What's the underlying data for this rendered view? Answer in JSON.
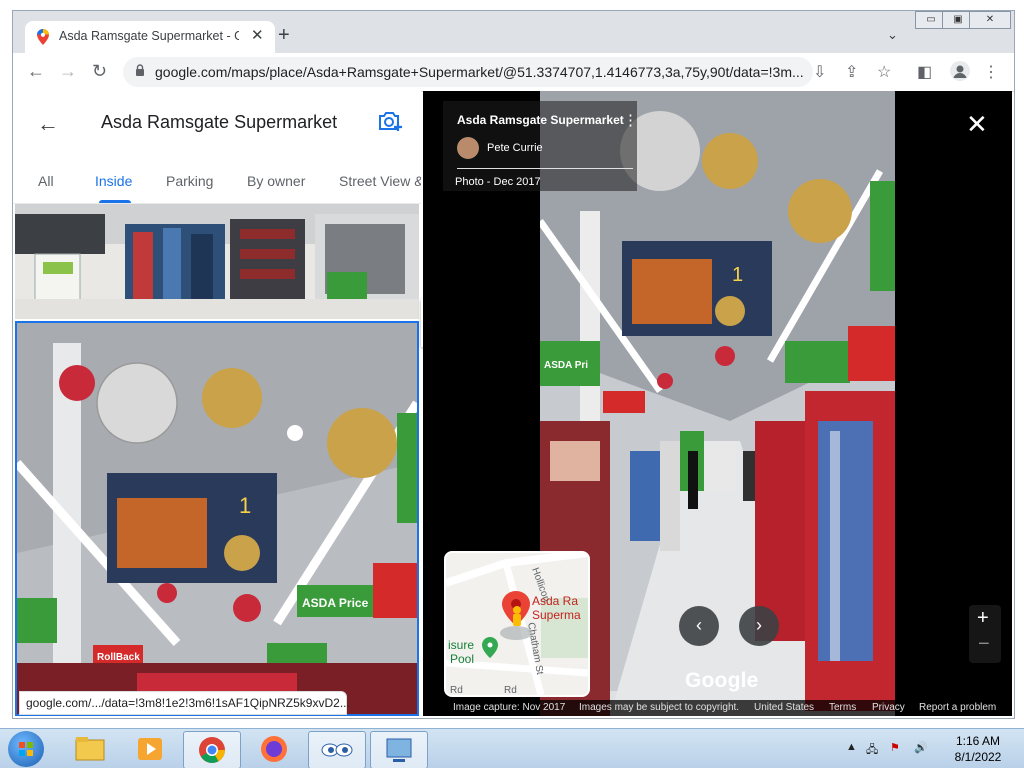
{
  "browser": {
    "tab_title": "Asda Ramsgate Supermarket - G",
    "new_tab": "+",
    "url": "google.com/maps/place/Asda+Ramsgate+Supermarket/@51.3374707,1.4146773,3a,75y,90t/data=!3m...",
    "status_url": "google.com/.../data=!3m8!1e2!3m6!1sAF1QipNRZ5k9xvD2..."
  },
  "panel": {
    "title": "Asda Ramsgate Supermarket",
    "tabs": [
      {
        "label": "All"
      },
      {
        "label": "Inside"
      },
      {
        "label": "Parking"
      },
      {
        "label": "By owner"
      },
      {
        "label": "Street View &"
      }
    ],
    "selected_tab": "Inside"
  },
  "viewer": {
    "place_name": "Asda Ramsgate Supermarket",
    "author": "Pete Currie",
    "photo_date": "Photo - Dec 2017",
    "google_logo": "Google",
    "minimap": {
      "place_label_1": "Asda Ra",
      "place_label_2": "Superma",
      "leisure_1": "isure",
      "leisure_2": "Pool",
      "street_1": "Hollicon",
      "street_2": "Chatham St",
      "road_1": "Rd",
      "road_2": "Rd"
    },
    "footer": {
      "capture": "Image capture: Nov 2017",
      "copyright": "Images may be subject to copyright.",
      "region": "United States",
      "terms": "Terms",
      "privacy": "Privacy",
      "report": "Report a problem"
    },
    "scene_signs": {
      "asda_price": "ASDA Price",
      "rollback": "RollBack",
      "asda_price_small": "ASDA Pri"
    }
  },
  "taskbar": {
    "time": "1:16 AM",
    "date": "8/1/2022"
  },
  "colors": {
    "accent": "#1a73e8",
    "asda_green": "#3a9b3a",
    "rollback_red": "#d42a2a"
  }
}
